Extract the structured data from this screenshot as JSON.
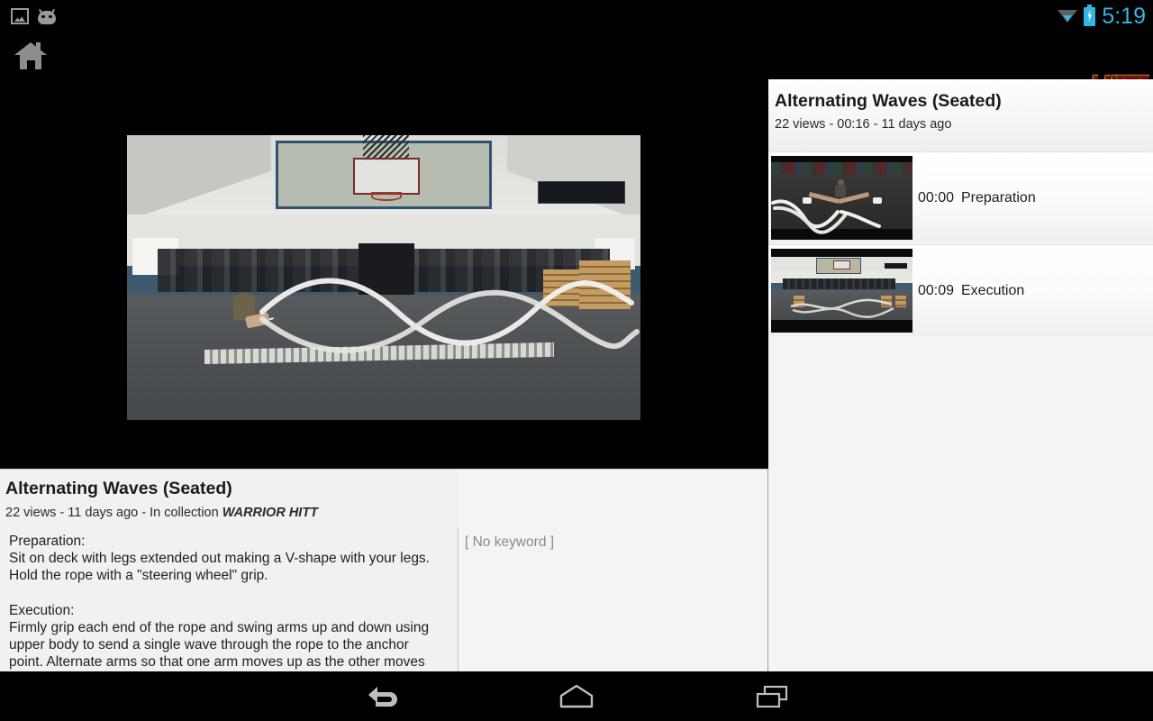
{
  "status_bar": {
    "icons": [
      "gallery-icon",
      "android-head-icon",
      "wifi-icon",
      "battery-charging-icon"
    ],
    "time": "5:19"
  },
  "action_bar": {
    "home_icon": "home-icon",
    "brand": "HITT"
  },
  "video": {
    "state": "playing",
    "scene_description": "gym interior with person seated on floor swinging battle ropes"
  },
  "info": {
    "title": "Alternating Waves (Seated)",
    "meta_prefix": "22 views - 11 days ago - In collection ",
    "collection": "WARRIOR HITT",
    "description": "Preparation:\nSit on deck with legs extended out making a V-shape with your legs.\nHold the rope with a \"steering wheel\" grip.\n\nExecution:\nFirmly grip each end of the rope and swing arms up and down using\nupper body to send a single wave through the rope to the anchor\npoint. Alternate arms so that one arm moves up as the other moves",
    "keyword": "[ No keyword ]"
  },
  "right_panel": {
    "title": "Alternating Waves (Seated)",
    "subtitle": "22 views - 00:16 - 11 days ago",
    "chapters": [
      {
        "time": "00:00",
        "label": "Preparation",
        "thumb": "seated-rope-thumbnail"
      },
      {
        "time": "00:09",
        "label": "Execution",
        "thumb": "gym-wide-thumbnail"
      }
    ]
  },
  "nav_bar": {
    "buttons": [
      {
        "name": "back-icon",
        "label": "Back"
      },
      {
        "name": "home-icon",
        "label": "Home"
      },
      {
        "name": "recents-icon",
        "label": "Recent apps"
      }
    ]
  },
  "colors": {
    "accent": "#33b5e5",
    "brand_fill": "#7e1010",
    "brand_stroke": "#d6a419",
    "panel_bg": "#f4f4f4",
    "info_bg": "#f1f1f1"
  }
}
